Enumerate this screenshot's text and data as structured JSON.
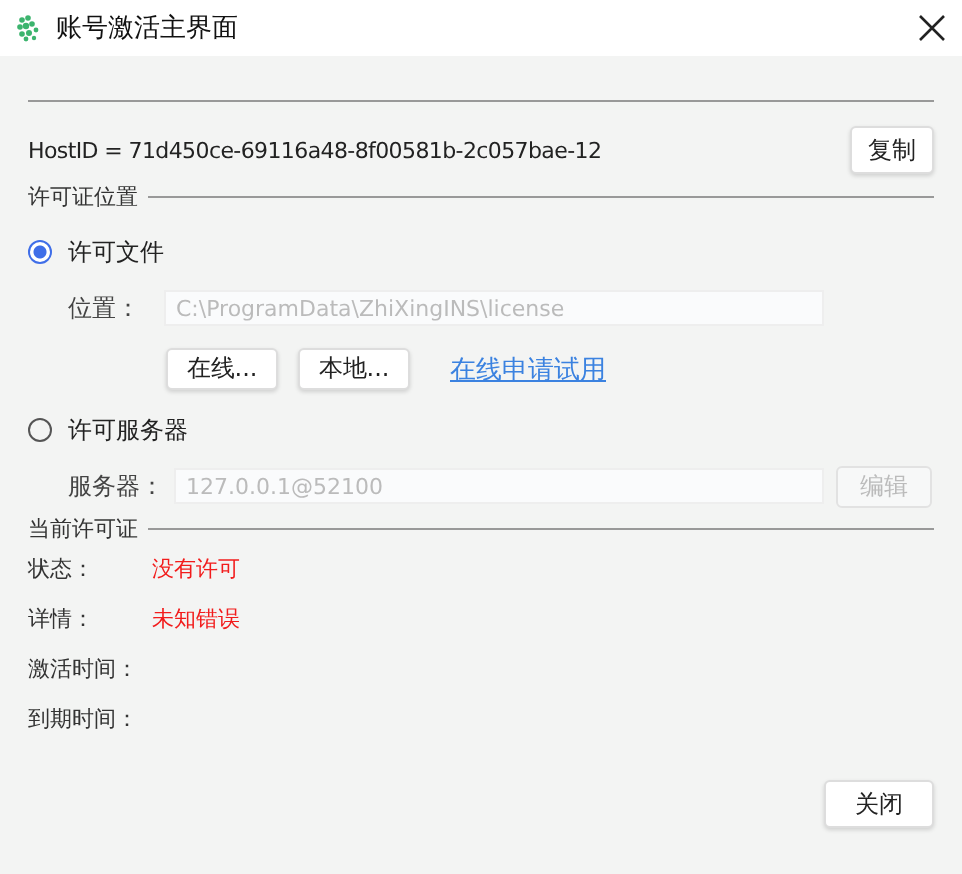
{
  "window": {
    "title": "账号激活主界面"
  },
  "host": {
    "text": "HostID = 71d450ce-69116a48-8f00581b-2c057bae-12",
    "copy_button": "复制"
  },
  "license_location": {
    "title": "许可证位置",
    "options": [
      {
        "kind": "file",
        "label": "许可文件",
        "selected": true,
        "field_label": "位置：",
        "field_value": "C:\\ProgramData\\ZhiXingINS\\license",
        "field_disabled": true,
        "buttons": [
          "在线...",
          "本地..."
        ],
        "link": "在线申请试用"
      },
      {
        "kind": "server",
        "label": "许可服务器",
        "selected": false,
        "field_label": "服务器：",
        "field_value": "127.0.0.1@52100",
        "field_disabled": true,
        "button": {
          "label": "编辑",
          "disabled": true
        }
      }
    ]
  },
  "current_license": {
    "title": "当前许可证",
    "rows": [
      {
        "label": "状态：",
        "value": "没有许可",
        "error": true
      },
      {
        "label": "详情：",
        "value": "未知错误",
        "error": true
      },
      {
        "label": "激活时间："
      },
      {
        "label": "到期时间："
      }
    ]
  },
  "close_button": "关闭"
}
